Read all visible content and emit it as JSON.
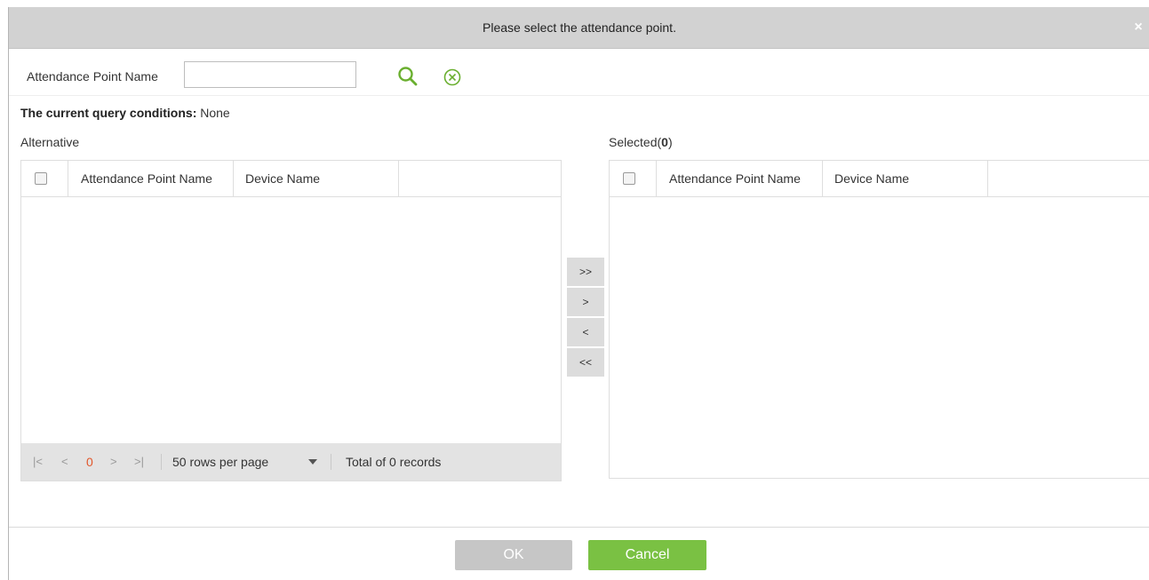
{
  "dialog": {
    "title": "Please select the attendance point.",
    "close_glyph": "×"
  },
  "search": {
    "label": "Attendance Point Name",
    "value": "",
    "placeholder": "",
    "search_icon": "search-icon",
    "clear_icon": "clear-circle-x-icon"
  },
  "query": {
    "label": "The current query conditions:",
    "value": "None"
  },
  "alternative": {
    "title": "Alternative",
    "columns": [
      "Attendance Point Name",
      "Device Name"
    ],
    "rows": []
  },
  "selected": {
    "title_prefix": "Selected(",
    "count": "0",
    "title_suffix": ")",
    "columns": [
      "Attendance Point Name",
      "Device Name"
    ],
    "rows": []
  },
  "pager": {
    "first": "|<",
    "prev": "<",
    "current_page": "0",
    "next": ">",
    "last": ">|",
    "rows_per_page": "50 rows per page",
    "total": "Total of 0 records"
  },
  "transfer": {
    "add_all": ">>",
    "add": ">",
    "remove": "<",
    "remove_all": "<<"
  },
  "buttons": {
    "ok": "OK",
    "cancel": "Cancel"
  },
  "colors": {
    "accent_green": "#7ac143",
    "icon_green": "#6aaf2f",
    "pager_current": "#e2572b",
    "title_bar": "#d2d2d2"
  }
}
